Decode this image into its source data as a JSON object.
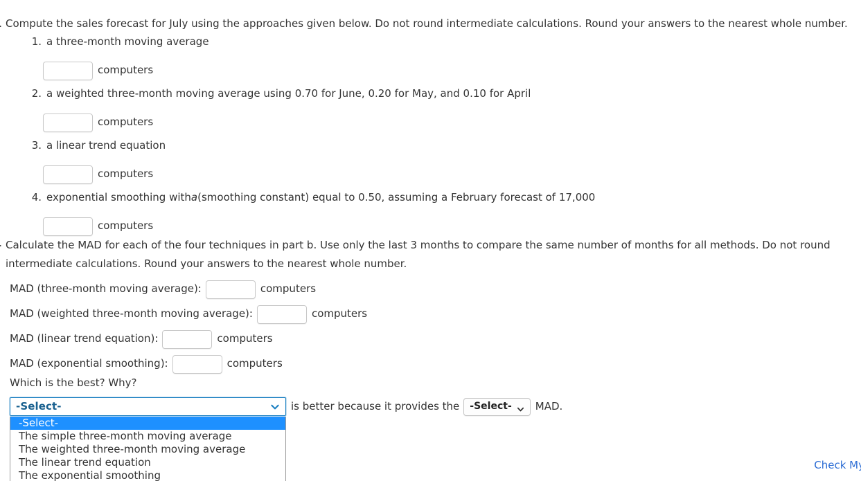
{
  "part_b": {
    "letter": "b.",
    "text": "Compute the sales forecast for July using the approaches given below. Do not round intermediate calculations. Round your answers to the nearest whole number.",
    "approaches": [
      {
        "number": "1.",
        "label": "a three-month moving average",
        "input_value": "",
        "unit": "computers"
      },
      {
        "number": "2.",
        "label": "a weighted three-month moving average using 0.70 for June, 0.20 for May, and 0.10 for April",
        "input_value": "",
        "unit": "computers"
      },
      {
        "number": "3.",
        "label": "a linear trend equation",
        "input_value": "",
        "unit": "computers"
      },
      {
        "number": "4.",
        "label_pre": "exponential smoothing with ",
        "label_symbol": "a",
        "label_post": " (smoothing constant) equal to 0.50, assuming a February forecast of 17,000",
        "input_value": "",
        "unit": "computers"
      }
    ]
  },
  "part_c": {
    "letter": "c.",
    "text": "Calculate the MAD for each of the four techniques in part b. Use only the last 3 months to compare the same number of months for all methods. Do not round intermediate calculations. Round your answers to the nearest whole number.",
    "mad_rows": [
      {
        "label": "MAD (three-month moving average):",
        "input_value": "",
        "unit": "computers"
      },
      {
        "label": "MAD (weighted three-month moving average):",
        "input_value": "",
        "unit": "computers"
      },
      {
        "label": "MAD (linear trend equation):",
        "input_value": "",
        "unit": "computers"
      },
      {
        "label": "MAD (exponential smoothing):",
        "input_value": "",
        "unit": "computers"
      }
    ],
    "which_best_prompt": "Which is the best? Why?",
    "method_select": {
      "selected": "-Select-",
      "expanded": true,
      "options": [
        "-Select-",
        "The simple three-month moving average",
        "The weighted three-month moving average",
        "The linear trend equation",
        "The exponential smoothing"
      ],
      "highlighted_index": 0
    },
    "middle_text": "is better because it provides the",
    "mad_select": {
      "selected": "-Select-"
    },
    "trailing_text": "MAD."
  },
  "footer": {
    "check_link": "Check My"
  },
  "colors": {
    "text": "#333333",
    "link": "#2b6cd4",
    "select_focus_border": "#1a7fc1",
    "select_value": "#18608f",
    "option_highlight": "#1e90ff",
    "input_border": "#c8c8c8"
  }
}
